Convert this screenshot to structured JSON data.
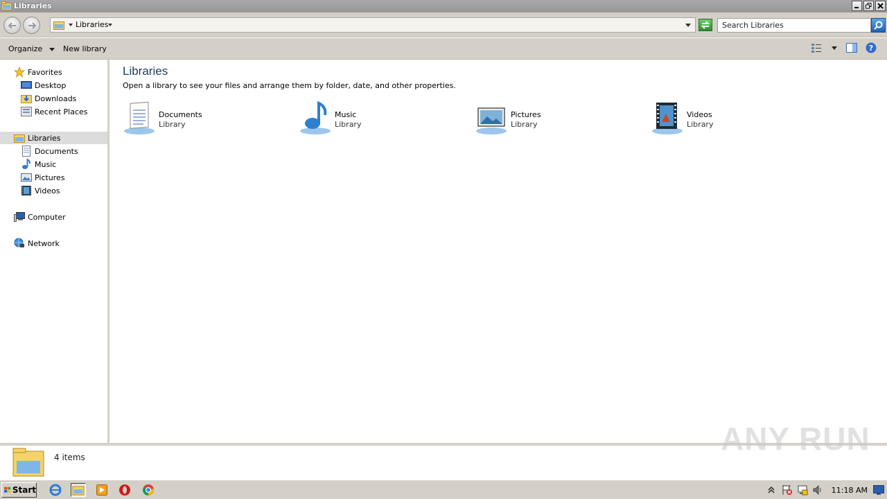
{
  "window": {
    "title": "Libraries"
  },
  "address": {
    "crumb": "Libraries",
    "search_placeholder": "Search Libraries"
  },
  "toolbar": {
    "organize": "Organize",
    "new_library": "New library"
  },
  "nav": {
    "favorites": {
      "label": "Favorites",
      "items": [
        {
          "label": "Desktop",
          "icon": "desktop-icon"
        },
        {
          "label": "Downloads",
          "icon": "downloads-icon"
        },
        {
          "label": "Recent Places",
          "icon": "recent-places-icon"
        }
      ]
    },
    "libraries": {
      "label": "Libraries",
      "items": [
        {
          "label": "Documents",
          "icon": "documents-icon"
        },
        {
          "label": "Music",
          "icon": "music-icon"
        },
        {
          "label": "Pictures",
          "icon": "pictures-icon"
        },
        {
          "label": "Videos",
          "icon": "videos-icon"
        }
      ]
    },
    "computer": {
      "label": "Computer"
    },
    "network": {
      "label": "Network"
    }
  },
  "content": {
    "title": "Libraries",
    "subtitle": "Open a library to see your files and arrange them by folder, date, and other properties.",
    "libraries": [
      {
        "name": "Documents",
        "type": "Library",
        "icon": "documents-library-icon"
      },
      {
        "name": "Music",
        "type": "Library",
        "icon": "music-library-icon"
      },
      {
        "name": "Pictures",
        "type": "Library",
        "icon": "pictures-library-icon"
      },
      {
        "name": "Videos",
        "type": "Library",
        "icon": "videos-library-icon"
      }
    ]
  },
  "status": {
    "count": "4 items"
  },
  "watermark": "ANY RUN",
  "taskbar": {
    "start": "Start",
    "clock": "11:18 AM"
  },
  "colors": {
    "accent": "#1e395b",
    "chrome": "#d4d0c8",
    "titlebar": "#a9a9a9"
  }
}
